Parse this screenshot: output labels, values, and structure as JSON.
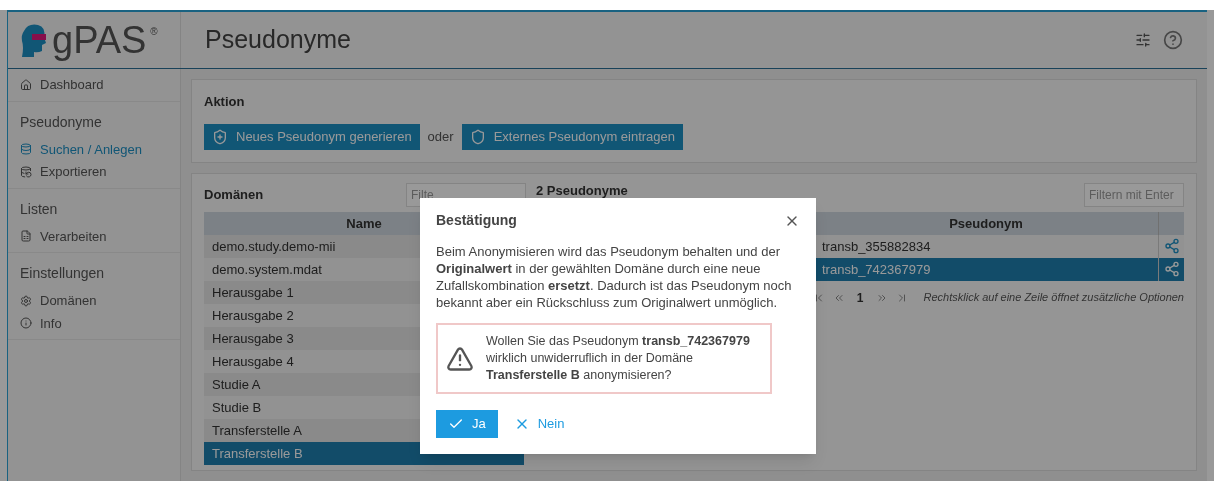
{
  "app": {
    "logo": "gPAS",
    "registered": "®"
  },
  "header": {
    "title": "Pseudonyme"
  },
  "sidebar": [
    {
      "items": [
        {
          "label": "Dashboard",
          "kind": "home",
          "selected": false
        }
      ]
    },
    {
      "title": "Pseudonyme",
      "items": [
        {
          "label": "Suchen / Anlegen",
          "kind": "search",
          "selected": true
        },
        {
          "label": "Exportieren",
          "kind": "export",
          "selected": false
        }
      ]
    },
    {
      "title": "Listen",
      "items": [
        {
          "label": "Verarbeiten",
          "kind": "file",
          "selected": false
        }
      ]
    },
    {
      "title": "Einstellungen",
      "items": [
        {
          "label": "Domänen",
          "kind": "settings",
          "selected": false
        },
        {
          "label": "Info",
          "kind": "info",
          "selected": false
        }
      ]
    }
  ],
  "action": {
    "title": "Aktion",
    "buttons": [
      "Neues Pseudonym generieren",
      "Externes Pseudonym eintragen"
    ],
    "separator": "oder"
  },
  "domains": {
    "title": "Domänen",
    "filter_placeholder": "Filte",
    "column": "Name",
    "rows": [
      {
        "name": "demo.study.demo-mii",
        "selected": false
      },
      {
        "name": "demo.system.mdat",
        "selected": false
      },
      {
        "name": "Herausgabe 1",
        "selected": false
      },
      {
        "name": "Herausgabe 2",
        "selected": false
      },
      {
        "name": "Herausgabe 3",
        "selected": false
      },
      {
        "name": "Herausgabe 4",
        "selected": false
      },
      {
        "name": "Studie A",
        "selected": false
      },
      {
        "name": "Studie B",
        "selected": false
      },
      {
        "name": "Transferstelle A",
        "selected": false
      },
      {
        "name": "Transferstelle B",
        "selected": true
      }
    ]
  },
  "pseudonyms": {
    "title": "2 Pseudonyme",
    "filter_placeholder": "Filtern mit Enter",
    "column": "Pseudonym",
    "rows": [
      {
        "pseudonym": "transb_355882834",
        "selected": false
      },
      {
        "pseudonym": "transb_742367979",
        "selected": true
      }
    ],
    "page": "1",
    "hint": "Rechtsklick auf eine Zeile öffnet zusätzliche Optionen"
  },
  "dialog": {
    "title": "Bestätigung",
    "text": "Beim Anonymisieren wird das Pseudonym behalten und der **Originalwert** in der gewählten Domäne durch eine neue Zufallskombination **ersetzt**. Dadurch ist das Pseudonym noch bekannt aber ein Rückschluss zum Originalwert unmöglich.",
    "warning": "Wollen Sie das Pseudonym **transb_742367979** wirklich unwiderruflich in der Domäne **Transferstelle B** anonymisieren?",
    "confirm": "Ja",
    "cancel": "Nein"
  }
}
